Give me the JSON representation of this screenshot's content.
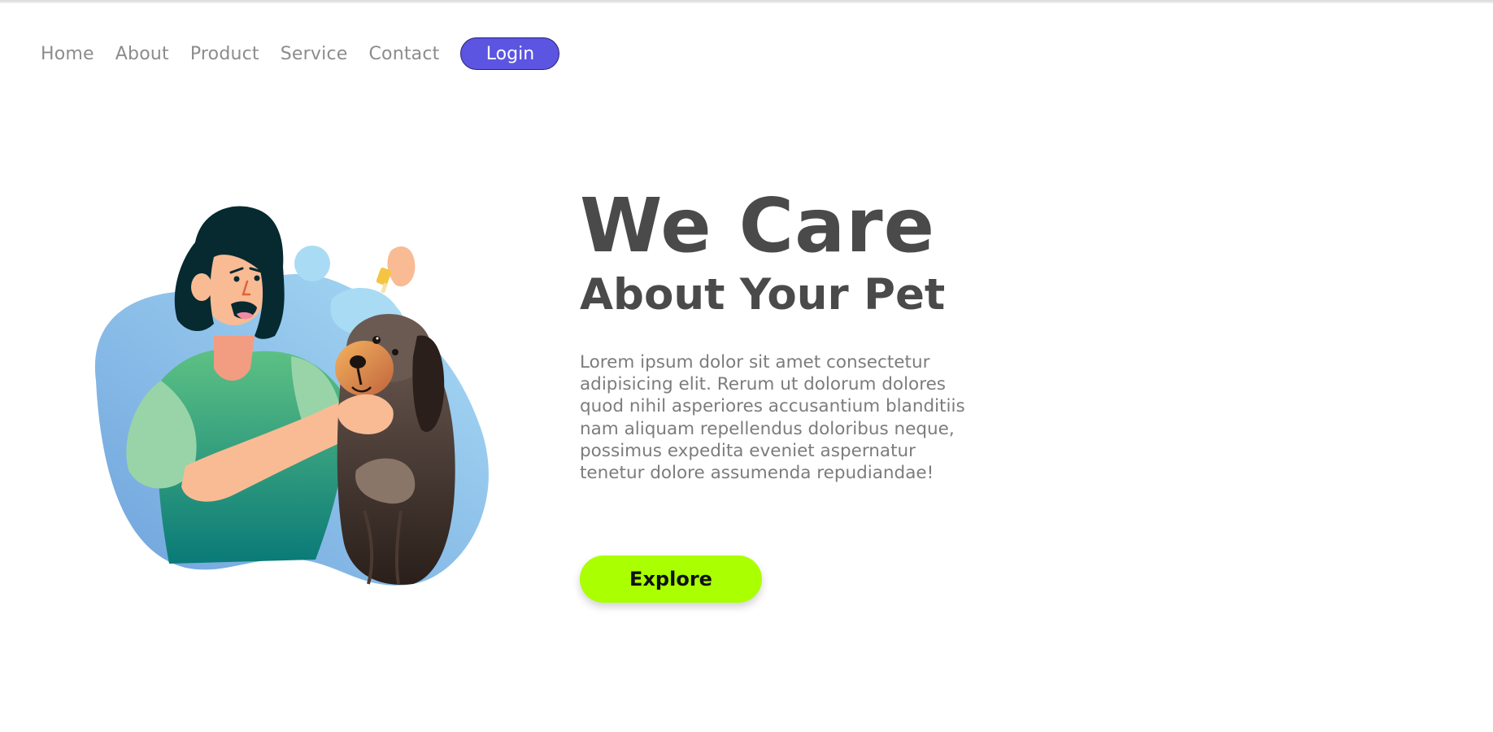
{
  "nav": {
    "items": [
      {
        "label": "Home"
      },
      {
        "label": "About"
      },
      {
        "label": "Product"
      },
      {
        "label": "Service"
      },
      {
        "label": "Contact"
      }
    ],
    "login_label": "Login"
  },
  "hero": {
    "title": "We Care",
    "subtitle": "About Your Pet",
    "description": "Lorem ipsum dolor sit amet consectetur adipisicing elit. Rerum ut dolorum dolores quod nihil asperiores accusantium blanditiis nam aliquam repellendus doloribus neque, possimus expedita eveniet aspernatur tenetur dolore assumenda repudiandae!",
    "cta_label": "Explore"
  },
  "colors": {
    "accent": "#5b55e1",
    "cta": "#aaff00",
    "heading": "#4a4a4a",
    "body_text": "#7c7c7c",
    "nav_text": "#8c8c8c"
  },
  "illustration": {
    "subject": "woman-giving-eye-drops-to-dog"
  }
}
